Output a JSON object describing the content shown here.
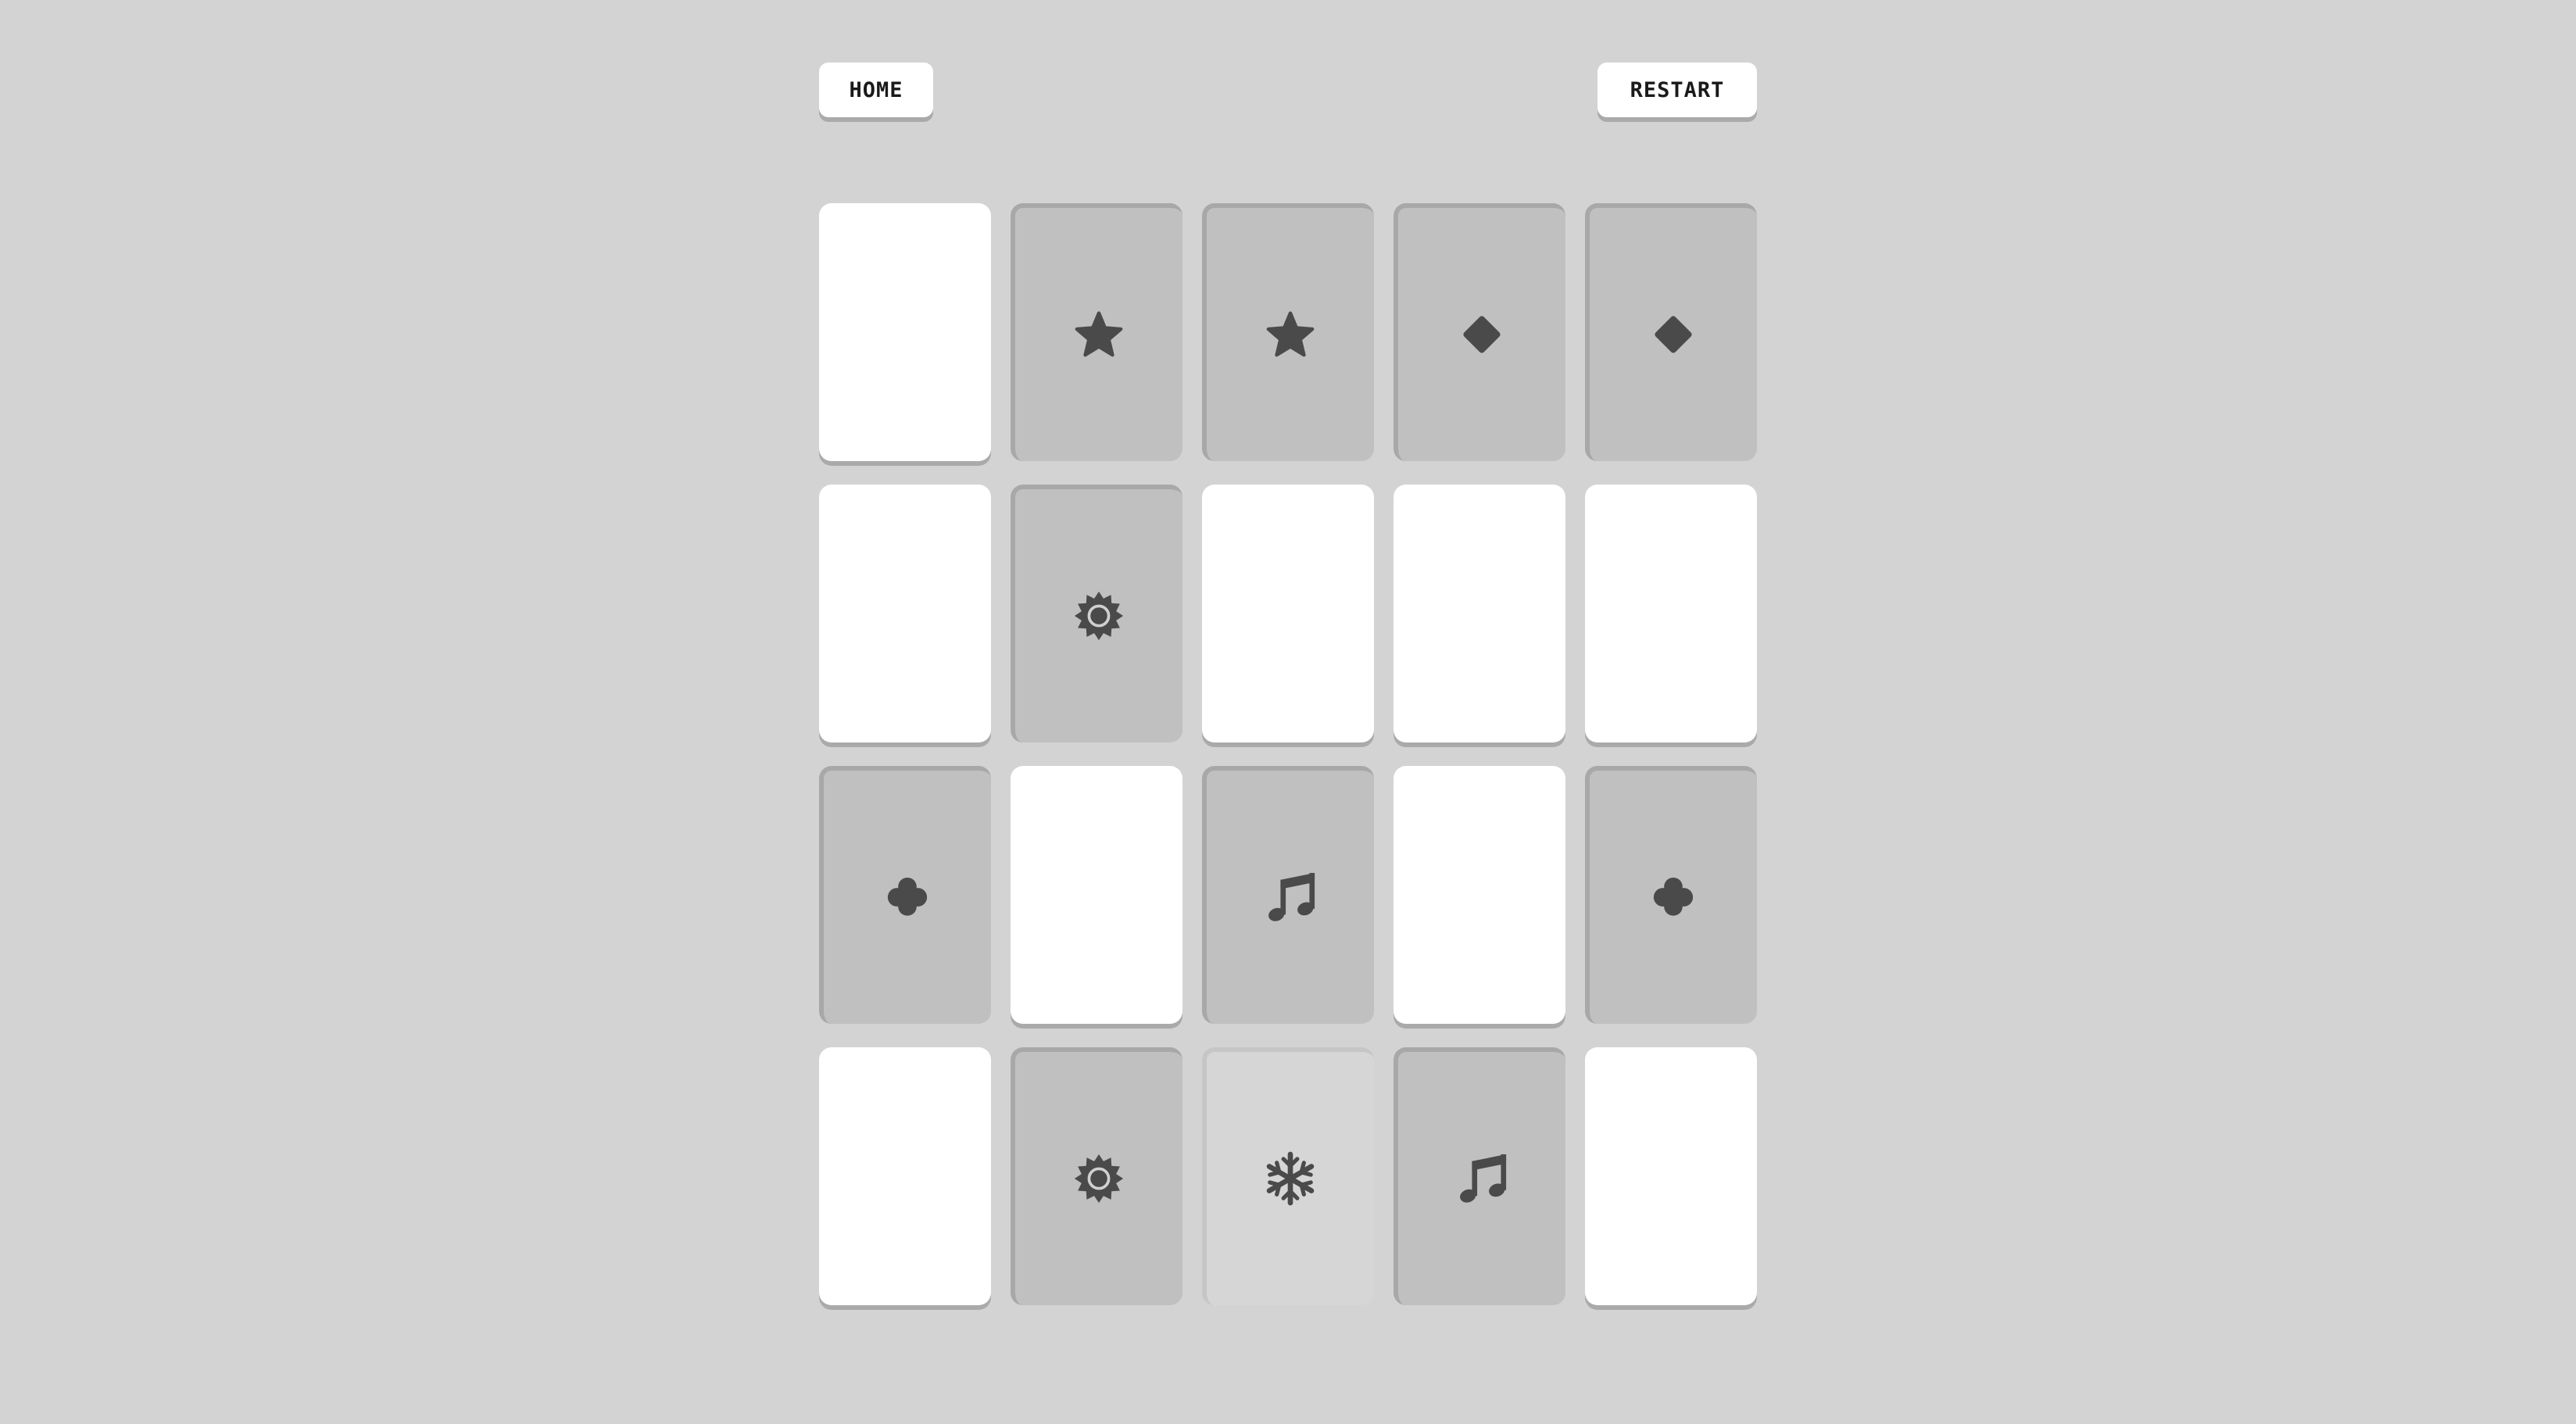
{
  "header": {
    "home_label": "HOME",
    "restart_label": "RESTART"
  },
  "board": {
    "columns": 5,
    "rows": 4,
    "cards": [
      {
        "state": "face-down",
        "symbol": null
      },
      {
        "state": "face-up",
        "symbol": "star"
      },
      {
        "state": "face-up",
        "symbol": "star"
      },
      {
        "state": "face-up",
        "symbol": "diamond"
      },
      {
        "state": "face-up",
        "symbol": "diamond"
      },
      {
        "state": "face-down",
        "symbol": null
      },
      {
        "state": "face-up",
        "symbol": "sun"
      },
      {
        "state": "face-down",
        "symbol": null
      },
      {
        "state": "face-down",
        "symbol": null
      },
      {
        "state": "face-down",
        "symbol": null
      },
      {
        "state": "face-up",
        "symbol": "clover"
      },
      {
        "state": "face-down",
        "symbol": null
      },
      {
        "state": "face-up",
        "symbol": "music-note"
      },
      {
        "state": "face-down",
        "symbol": null
      },
      {
        "state": "face-up",
        "symbol": "clover"
      },
      {
        "state": "face-down",
        "symbol": null
      },
      {
        "state": "face-up",
        "symbol": "sun"
      },
      {
        "state": "face-up-active",
        "symbol": "snowflake"
      },
      {
        "state": "face-up",
        "symbol": "music-note"
      },
      {
        "state": "face-down",
        "symbol": null
      }
    ]
  },
  "colors": {
    "background": "#d3d3d3",
    "card_back": "#ffffff",
    "card_face": "#c0c0c0",
    "card_face_active": "#d6d6d6",
    "symbol": "#4a4a4a"
  }
}
